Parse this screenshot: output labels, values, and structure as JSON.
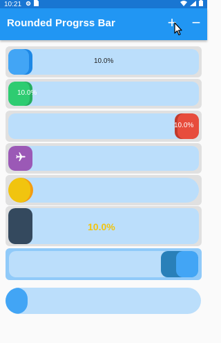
{
  "status_bar": {
    "time": "10:21",
    "icons": [
      "gear-icon",
      "sim-card-icon",
      "wifi-icon",
      "signal-icon",
      "battery-icon"
    ]
  },
  "app_bar": {
    "title": "Rounded Progrss Bar",
    "add_icon": "+",
    "remove_icon": "−"
  },
  "progress_bars": [
    {
      "id": 1,
      "progress": 0.1,
      "label": "10.0%",
      "fill_color": "#42a5f5",
      "shade_color": "#1e88e5"
    },
    {
      "id": 2,
      "progress": 0.1,
      "label": "10.0%",
      "fill_color": "#2ecc71",
      "shade_color": "#27ae60"
    },
    {
      "id": 3,
      "progress": 0.1,
      "label": "10.0%",
      "fill_color": "#e74c3c",
      "shade_color": "#c0392b",
      "direction": "right-to-left"
    },
    {
      "id": 4,
      "progress": 0.1,
      "label": "",
      "fill_color": "#9b59b6",
      "icon": "airplane-icon"
    },
    {
      "id": 5,
      "progress": 0.1,
      "label": "",
      "fill_color": "#f1c40f",
      "shade_color": "#f39c12"
    },
    {
      "id": 6,
      "progress": 0.1,
      "label": "10.0%",
      "fill_color": "#34495e",
      "label_color": "#f1c40f"
    },
    {
      "id": 7,
      "progress": 0.2,
      "label": "",
      "fill_color": "#42a5f5",
      "shade_color": "#2980b9",
      "direction": "right-to-left"
    },
    {
      "id": 8,
      "progress": 0.1,
      "label": "",
      "fill_color": "#42a5f5"
    }
  ],
  "colors": {
    "app_bar": "#2196f3",
    "status_bar": "#1976d2",
    "track": "#bbdefb",
    "wrapper": "#e0e0e0"
  }
}
